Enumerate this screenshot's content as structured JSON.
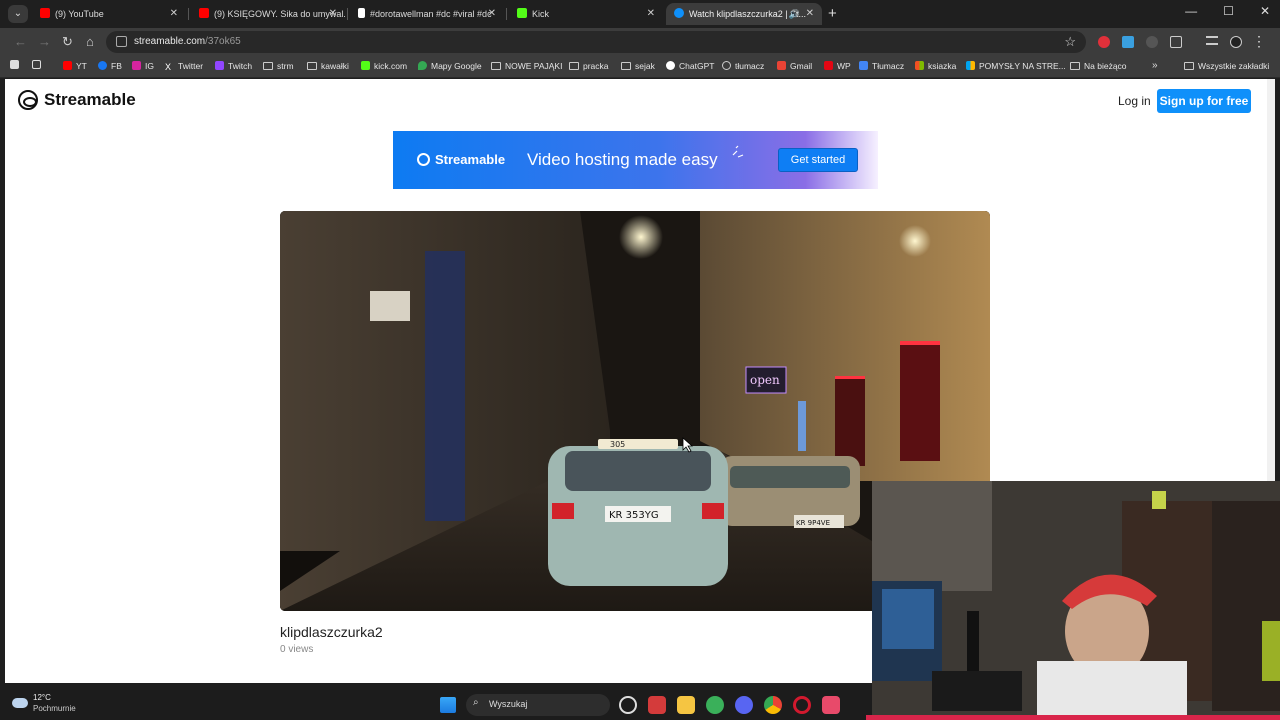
{
  "browser": {
    "tabs": [
      {
        "title": "(9) YouTube",
        "favicon_color": "#ff0000"
      },
      {
        "title": "(9) KSIĘGOWY. Sika do umywal...",
        "favicon_color": "#ff0000"
      },
      {
        "title": "#dorotawellman #dc #viral #dc",
        "favicon_color": "#ffffff"
      },
      {
        "title": "Kick",
        "favicon_color": "#53fc18"
      },
      {
        "title": "Watch klipdlaszczurka2 | St...",
        "favicon_color": "#0f90fa",
        "active": true
      }
    ],
    "address": {
      "host": "streamable.com",
      "path": "/37ok65"
    },
    "bookmarks": [
      {
        "label": "YT",
        "color": "#ff0000"
      },
      {
        "label": "FB",
        "color": "#1877f2"
      },
      {
        "label": "IG",
        "color": "#d6249f"
      },
      {
        "label": "Twitter",
        "color": "#ffffff"
      },
      {
        "label": "Twitch",
        "color": "#9146ff"
      },
      {
        "label": "strm",
        "folder": true
      },
      {
        "label": "kawałki",
        "folder": true
      },
      {
        "label": "kick.com",
        "color": "#53fc18"
      },
      {
        "label": "Mapy Google",
        "color": "#34a853"
      },
      {
        "label": "NOWE PAJĄKI",
        "folder": true
      },
      {
        "label": "pracka",
        "folder": true
      },
      {
        "label": "sejak",
        "folder": true
      },
      {
        "label": "ChatGPT",
        "color": "#ffffff"
      },
      {
        "label": "tłumacz",
        "color": "#cccccc"
      },
      {
        "label": "Gmail",
        "color": "#ea4335"
      },
      {
        "label": "WP",
        "color": "#e30613"
      },
      {
        "label": "Tłumacz",
        "color": "#4285f4"
      },
      {
        "label": "ksiazka",
        "color": "#f25022"
      },
      {
        "label": "POMYSŁY NA STRE...",
        "color": "#7fba00"
      },
      {
        "label": "Na bieżąco",
        "folder": true
      }
    ],
    "all_bookmarks": "Wszystkie zakładki"
  },
  "page": {
    "brand": "Streamable",
    "login": "Log in",
    "signup": "Sign up for free",
    "ad": {
      "brand": "Streamable",
      "tagline": "Video hosting made easy",
      "cta": "Get started"
    },
    "video": {
      "title": "klipdlaszczurka2",
      "views": "0 views",
      "plate_taxi": "KR 353YG",
      "plate_bmw": "KR 9P4VE",
      "taxi_sign": "305",
      "neon_sign": "open"
    }
  },
  "taskbar": {
    "temperature": "12°C",
    "weather": "Pochmurnie",
    "search_placeholder": "Wyszukaj"
  },
  "colors": {
    "accent": "#0f90fa",
    "signup_bg": "#0f90fa",
    "chrome_bg": "#3c3c3c"
  }
}
